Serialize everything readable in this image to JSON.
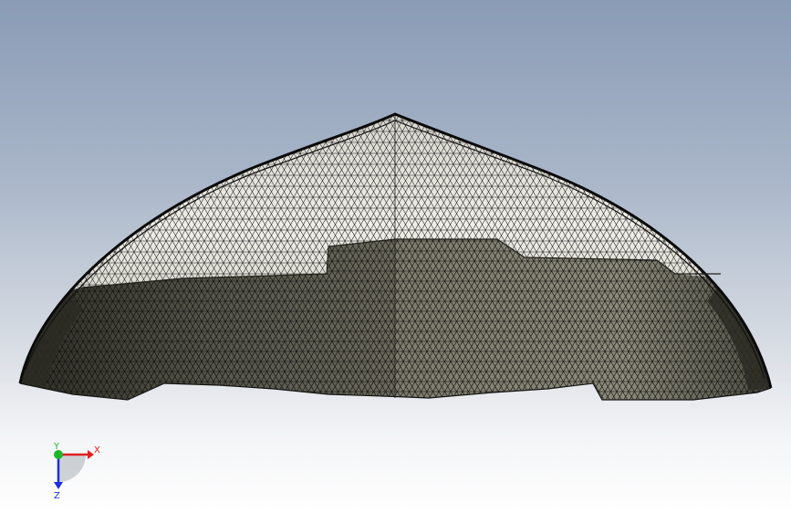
{
  "viewport": {
    "background_top": "#8a9bb5",
    "background_bottom": "#ffffff"
  },
  "model": {
    "name": "",
    "display_style": "mesh-wireframe-shaded",
    "mesh_color": "#111111",
    "inner_fill": "#6e6d5f",
    "outer_fill": "#e9e8df"
  },
  "triad": {
    "x_label": "X",
    "y_label": "Y",
    "z_label": "Z",
    "x_color": "#e01f1f",
    "y_color": "#1fb52a",
    "z_color": "#1f2fd6"
  }
}
